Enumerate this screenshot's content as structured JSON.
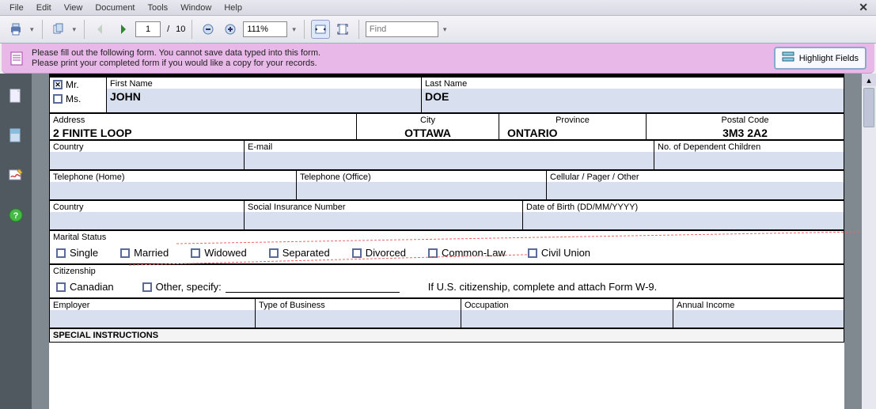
{
  "menu": {
    "file": "File",
    "edit": "Edit",
    "view": "View",
    "document": "Document",
    "tools": "Tools",
    "window": "Window",
    "help": "Help"
  },
  "toolbar": {
    "page_current": "1",
    "page_sep": "/",
    "page_total": "10",
    "zoom": "111%",
    "find_placeholder": "Find"
  },
  "banner": {
    "line1": "Please fill out the following form. You cannot save data typed into this form.",
    "line2": "Please print your completed form if you would like a copy for your records.",
    "highlight_label": "Highlight Fields"
  },
  "form": {
    "salutation": {
      "mr": "Mr.",
      "ms": "Ms.",
      "mr_checked": true,
      "ms_checked": false
    },
    "first_name_label": "First Name",
    "first_name": "JOHN",
    "last_name_label": "Last Name",
    "last_name": "DOE",
    "address_label": "Address",
    "address": "2 FINITE LOOP",
    "city_label": "City",
    "city": "OTTAWA",
    "province_label": "Province",
    "province": "ONTARIO",
    "postal_label": "Postal Code",
    "postal": "3M3 2A2",
    "country_label": "Country",
    "email_label": "E-mail",
    "dep_children_label": "No. of Dependent Children",
    "tel_home_label": "Telephone (Home)",
    "tel_office_label": "Telephone (Office)",
    "cell_label": "Cellular / Pager / Other",
    "country2_label": "Country",
    "sin_label": "Social Insurance Number",
    "dob_label": "Date of Birth (DD/MM/YYYY)",
    "marital_label": "Marital Status",
    "marital_opts": [
      "Single",
      "Married",
      "Widowed",
      "Separated",
      "Divorced",
      "Common-Law",
      "Civil Union"
    ],
    "citizenship_label": "Citizenship",
    "citizenship_canadian": "Canadian",
    "citizenship_other": "Other, specify:",
    "citizenship_us_note": "If U.S. citizenship, complete and attach Form W-9.",
    "employer_label": "Employer",
    "biztype_label": "Type of Business",
    "occupation_label": "Occupation",
    "income_label": "Annual Income",
    "special_instr": "SPECIAL INSTRUCTIONS"
  }
}
